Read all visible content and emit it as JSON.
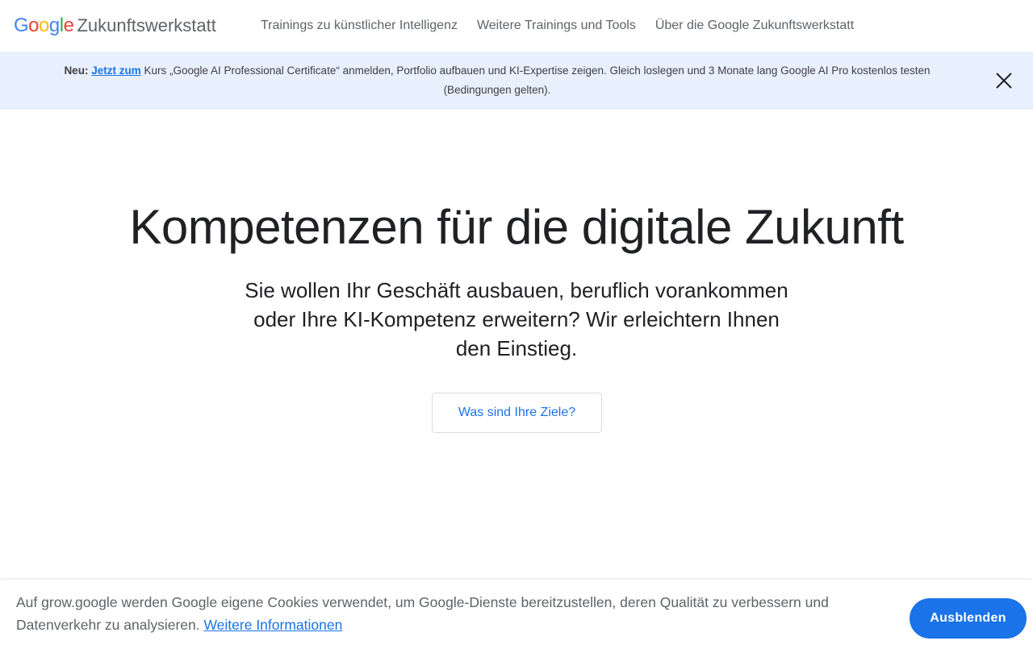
{
  "header": {
    "logo_letters": [
      "G",
      "o",
      "o",
      "g",
      "l",
      "e"
    ],
    "product_name": "Zukunftswerkstatt",
    "nav": [
      {
        "label": "Trainings zu künstlicher Intelligenz"
      },
      {
        "label": "Weitere Trainings und Tools"
      },
      {
        "label": "Über die Google Zukunftswerkstatt"
      }
    ]
  },
  "banner": {
    "prefix": "Neu:",
    "link_label": "Jetzt zum",
    "text": " Kurs „Google AI Professional Certificate“ anmelden, Portfolio aufbauen und KI-Expertise zeigen. Gleich loslegen und 3 Monate lang Google AI Pro kostenlos testen (Bedingungen gelten).",
    "close_icon": "close-icon"
  },
  "hero": {
    "title": "Kompetenzen für die digitale Zukunft",
    "subtitle": "Sie wollen Ihr Geschäft ausbauen, beruflich vorankommen oder Ihre KI-Kompetenz erweitern? Wir erleichtern Ihnen den Einstieg.",
    "cta_label": "Was sind Ihre Ziele?"
  },
  "cookie": {
    "text": "Auf grow.google werden Google eigene Cookies verwendet, um Google-Dienste bereitzustellen, deren Qualität zu verbessern und Datenverkehr zu analysieren. ",
    "link_label": "Weitere Informationen",
    "button_label": "Ausblenden"
  },
  "colors": {
    "accent": "#1a73e8",
    "banner_bg": "#e8f0fe",
    "text_primary": "#202124",
    "text_secondary": "#5f6368"
  }
}
